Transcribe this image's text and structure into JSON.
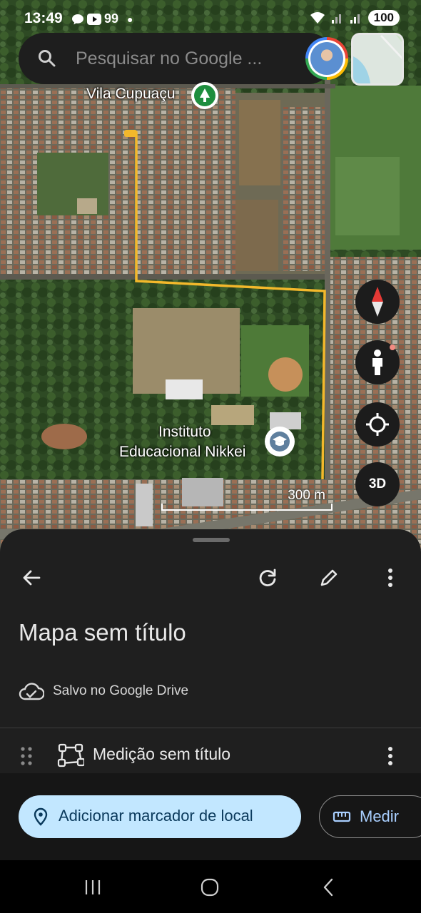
{
  "status_bar": {
    "time": "13:49",
    "notification_count": "99",
    "battery": "100"
  },
  "search": {
    "placeholder": "Pesquisar no Google ..."
  },
  "map": {
    "labels": {
      "vila": "Vila Cupuaçu",
      "instituto_line1": "Instituto",
      "instituto_line2": "Educacional Nikkei"
    },
    "scale_label": "300 m",
    "button_3d": "3D",
    "route_color": "#f3b82b"
  },
  "sheet": {
    "title": "Mapa sem título",
    "saved_text": "Salvo no Google Drive",
    "item_label": "Medição sem título",
    "primary_button": "Adicionar marcador de local",
    "secondary_button": "Medir"
  },
  "colors": {
    "accent_button": "#c2e7ff",
    "accent_text": "#0b3a5c",
    "sheet_bg": "#1f1f1f"
  }
}
